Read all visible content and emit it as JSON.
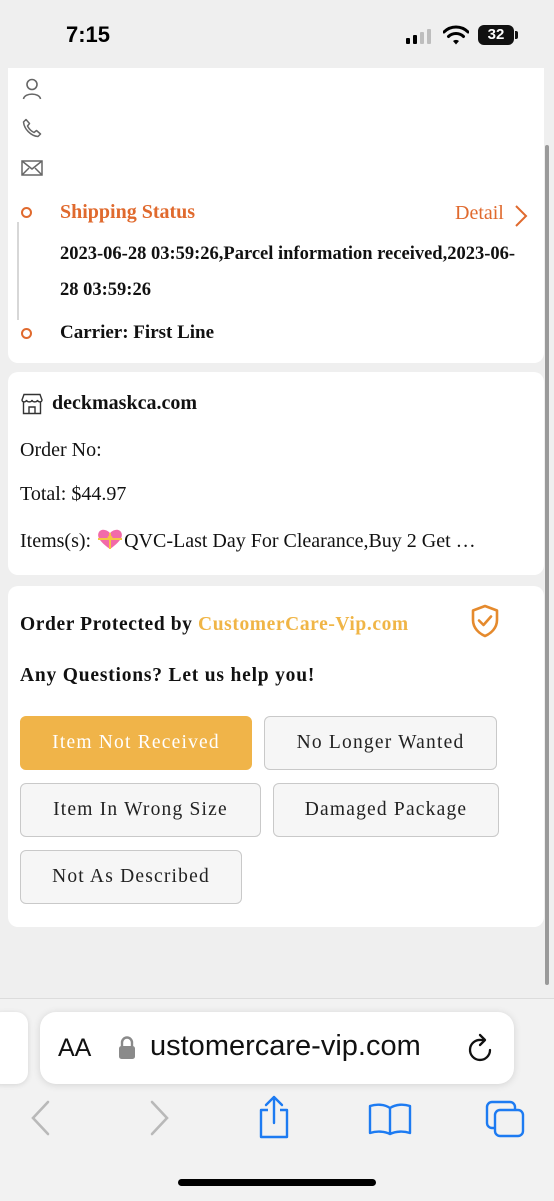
{
  "status_bar": {
    "time": "7:15",
    "battery": "32"
  },
  "contact": {
    "icons": [
      "person-icon",
      "phone-icon",
      "mail-icon"
    ]
  },
  "shipping": {
    "title": "Shipping Status",
    "detail_label": "Detail",
    "latest_event": "2023-06-28 03:59:26,Parcel information received,2023-06-28 03:59:26",
    "carrier": "Carrier: First Line"
  },
  "order": {
    "store": "deckmaskca.com",
    "order_no": "Order No:",
    "total": "Total: $44.97",
    "items_label": "Items(s):",
    "items_value": "QVC-Last Day For Clearance,Buy 2 Get …"
  },
  "protection": {
    "prefix": "Order Protected by",
    "brand": "CustomerCare-Vip.com",
    "question": "Any Questions? Let us help you!",
    "options": [
      "Item Not Received",
      "No Longer Wanted",
      "Item In Wrong Size",
      "Damaged Package",
      "Not As Described"
    ],
    "selected": "Item Not Received"
  },
  "browser": {
    "aa_label": "AA",
    "url": "ustomercare-vip.com"
  },
  "colors": {
    "accent_orange": "#e06a2e",
    "button_gold": "#f0b449",
    "brand_gold": "#f0b546"
  }
}
